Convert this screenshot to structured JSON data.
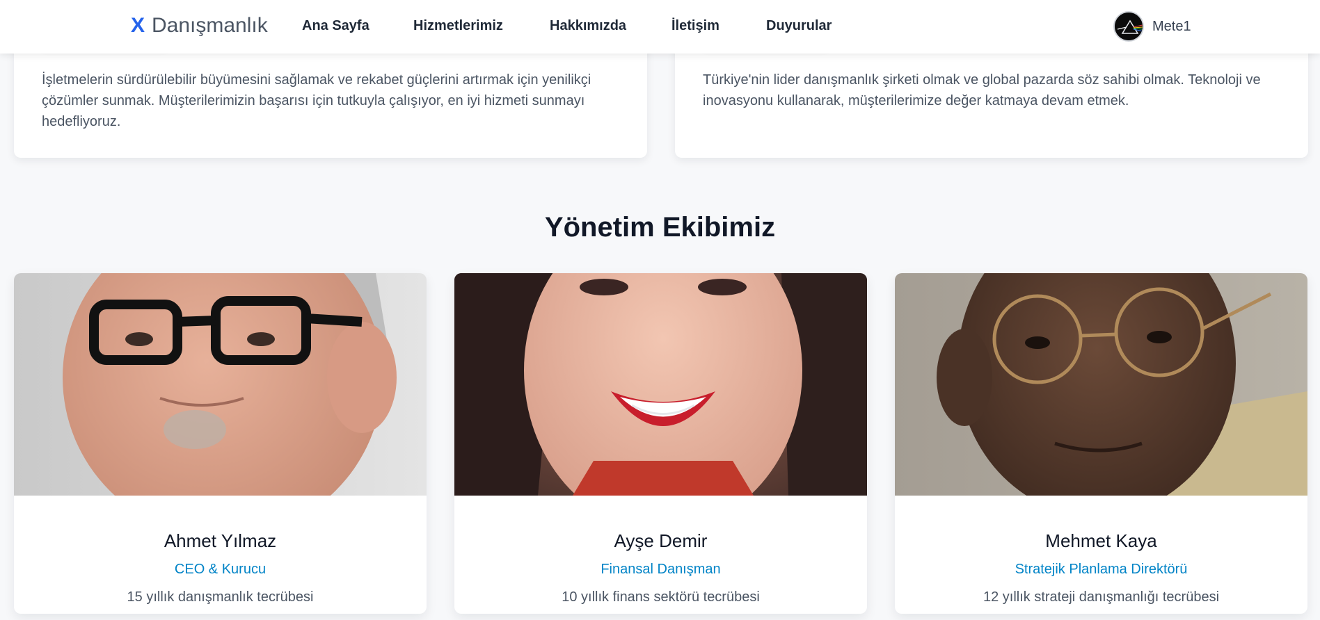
{
  "header": {
    "brand_mark": "X",
    "brand_name": "Danışmanlık",
    "nav": [
      {
        "label": "Ana Sayfa"
      },
      {
        "label": "Hizmetlerimiz"
      },
      {
        "label": "Hakkımızda"
      },
      {
        "label": "İletişim"
      },
      {
        "label": "Duyurular"
      }
    ],
    "user_name": "Mete1",
    "accent_color": "#2563eb"
  },
  "mission": {
    "text": "İşletmelerin sürdürülebilir büyümesini sağlamak ve rekabet güçlerini artırmak için yenilikçi çözümler sunmak. Müşterilerimizin başarısı için tutkuyla çalışıyor, en iyi hizmeti sunmayı hedefliyoruz."
  },
  "vision": {
    "text": "Türkiye'nin lider danışmanlık şirketi olmak ve global pazarda söz sahibi olmak. Teknoloji ve inovasyonu kullanarak, müşterilerimize değer katmaya devam etmek."
  },
  "team": {
    "title": "Yönetim Ekibimiz",
    "members": [
      {
        "name": "Ahmet Yılmaz",
        "role": "CEO & Kurucu",
        "experience": "15 yıllık danışmanlık tecrübesi"
      },
      {
        "name": "Ayşe Demir",
        "role": "Finansal Danışman",
        "experience": "10 yıllık finans sektörü tecrübesi"
      },
      {
        "name": "Mehmet Kaya",
        "role": "Stratejik Planlama Direktörü",
        "experience": "12 yıllık strateji danışmanlığı tecrübesi"
      }
    ],
    "role_color": "#0284c7"
  }
}
